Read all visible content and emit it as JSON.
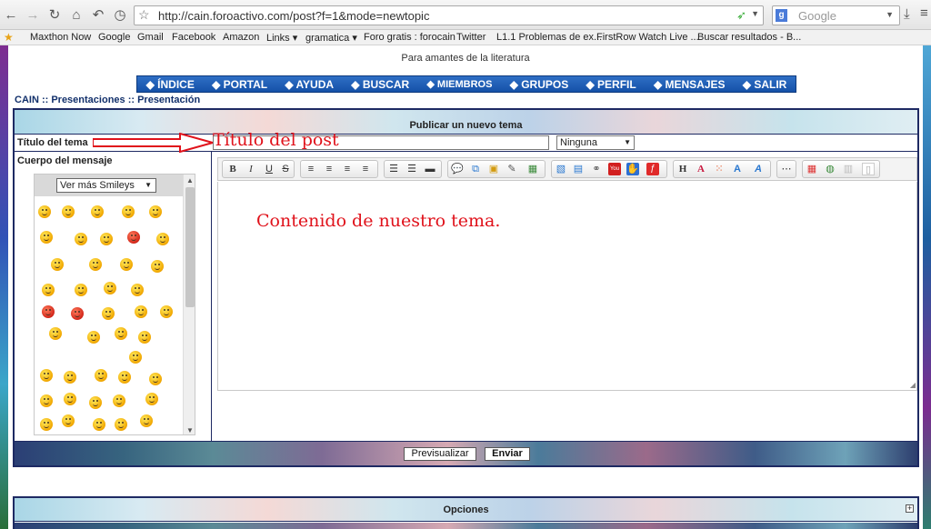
{
  "browser": {
    "url": "http://cain.foroactivo.com/post?f=1&mode=newtopic",
    "search_placeholder": "Google",
    "search_engine_letter": "g",
    "bookmarks": [
      "Maxthon Now",
      "Google",
      "Gmail",
      "Facebook",
      "Amazon",
      "Links ▾",
      "gramatica ▾",
      "Foro gratis : forocain",
      "Twitter",
      "L1.1 Problemas de ex...",
      "FirstRow Watch Live ...",
      "Buscar resultados - B..."
    ]
  },
  "site": {
    "description": "Para amantes de la literatura",
    "nav": [
      "ÍNDICE",
      "PORTAL",
      "AYUDA",
      "BUSCAR",
      "MIEMBROS",
      "GRUPOS",
      "PERFIL",
      "MENSAJES",
      "SALIR"
    ],
    "breadcrumb": "CAIN :: Presentaciones :: Presentación"
  },
  "form": {
    "header": "Publicar un nuevo tema",
    "title_label": "Título del tema",
    "title_annotation": "Título del post",
    "topic_type": "Ninguna",
    "body_label": "Cuerpo del mensaje",
    "smileys_select": "Ver más Smileys",
    "body_annotation": "Contenido de nuestro tema.",
    "preview_button": "Previsualizar",
    "send_button": "Enviar",
    "options_header": "Opciones",
    "options_toggle": "+"
  },
  "toolbar": {
    "bold": "B",
    "italic": "I",
    "underline": "U",
    "strike": "S",
    "heading": "H",
    "youtube": "You"
  },
  "colors": {
    "annotation_red": "#e0121b",
    "nav_blue": "#1a5cb5",
    "border_navy": "#1e2a63"
  }
}
